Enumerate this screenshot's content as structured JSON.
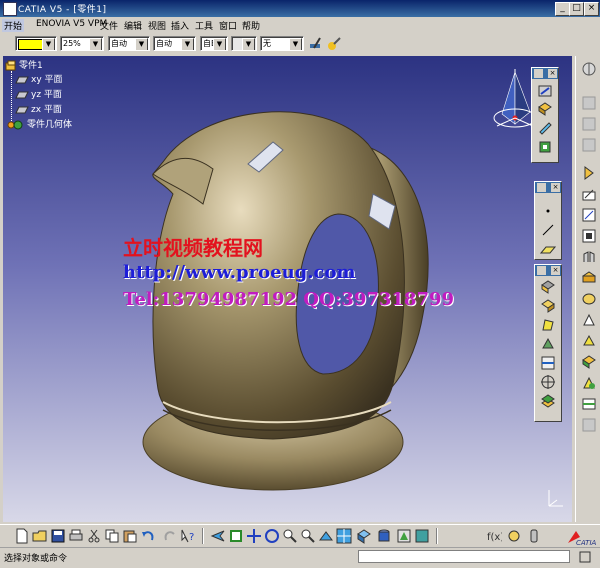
{
  "window": {
    "title": "CATIA V5 - [零件1]",
    "min_label": "_",
    "max_label": "□",
    "close_label": "×"
  },
  "menu": [
    "开始",
    "ENOVIA V5 VPM",
    "文件",
    "编辑",
    "视图",
    "插入",
    "工具",
    "窗口",
    "帮助"
  ],
  "style_toolbar": {
    "color_swatch": "#ffff00",
    "transparency": "25%",
    "line_thickness": "自动",
    "line_type": "自动",
    "point_symbol": "自动",
    "layer_short": "自B",
    "layer": "无"
  },
  "tree": {
    "root": "零件1",
    "items": [
      "xy 平面",
      "yz 平面",
      "zx 平面",
      "零件几何体"
    ]
  },
  "watermark": {
    "line1": "立时视频教程网",
    "line2": "http://www.proeug.com",
    "line3": "Tel:13794987192  QQ:397318799"
  },
  "toolbars": {
    "top_icons": [
      "sketch-icon",
      "pad-icon",
      "pocket-icon",
      "shaft-icon"
    ],
    "middle_icons": [
      "point-icon",
      "line-icon",
      "plane-icon"
    ],
    "lower_icons": [
      "measure-icon",
      "surface-icon",
      "fill-icon",
      "extrude-icon",
      "split-icon",
      "axis-icon",
      "boolean-icon"
    ],
    "right_dock_icons": [
      "plan-icon",
      "sketch-icon",
      "pad-icon",
      "pocket-icon",
      "rib-icon",
      "hole-icon",
      "fillet-icon",
      "chamfer-icon",
      "draft-icon",
      "shell-icon",
      "thickness-icon",
      "mirror-icon",
      "pattern-icon",
      "scale-icon",
      "update-icon",
      "constraint-icon",
      "analysis-icon"
    ]
  },
  "status_bar": {
    "message": "选择对象或命令"
  },
  "colors": {
    "kettle": "#8a7d5f",
    "canvas_top": "#2c3382",
    "canvas_bottom": "#d8d8e8",
    "watermark_red": "#e3121e",
    "watermark_blue": "#1d1dd8"
  }
}
